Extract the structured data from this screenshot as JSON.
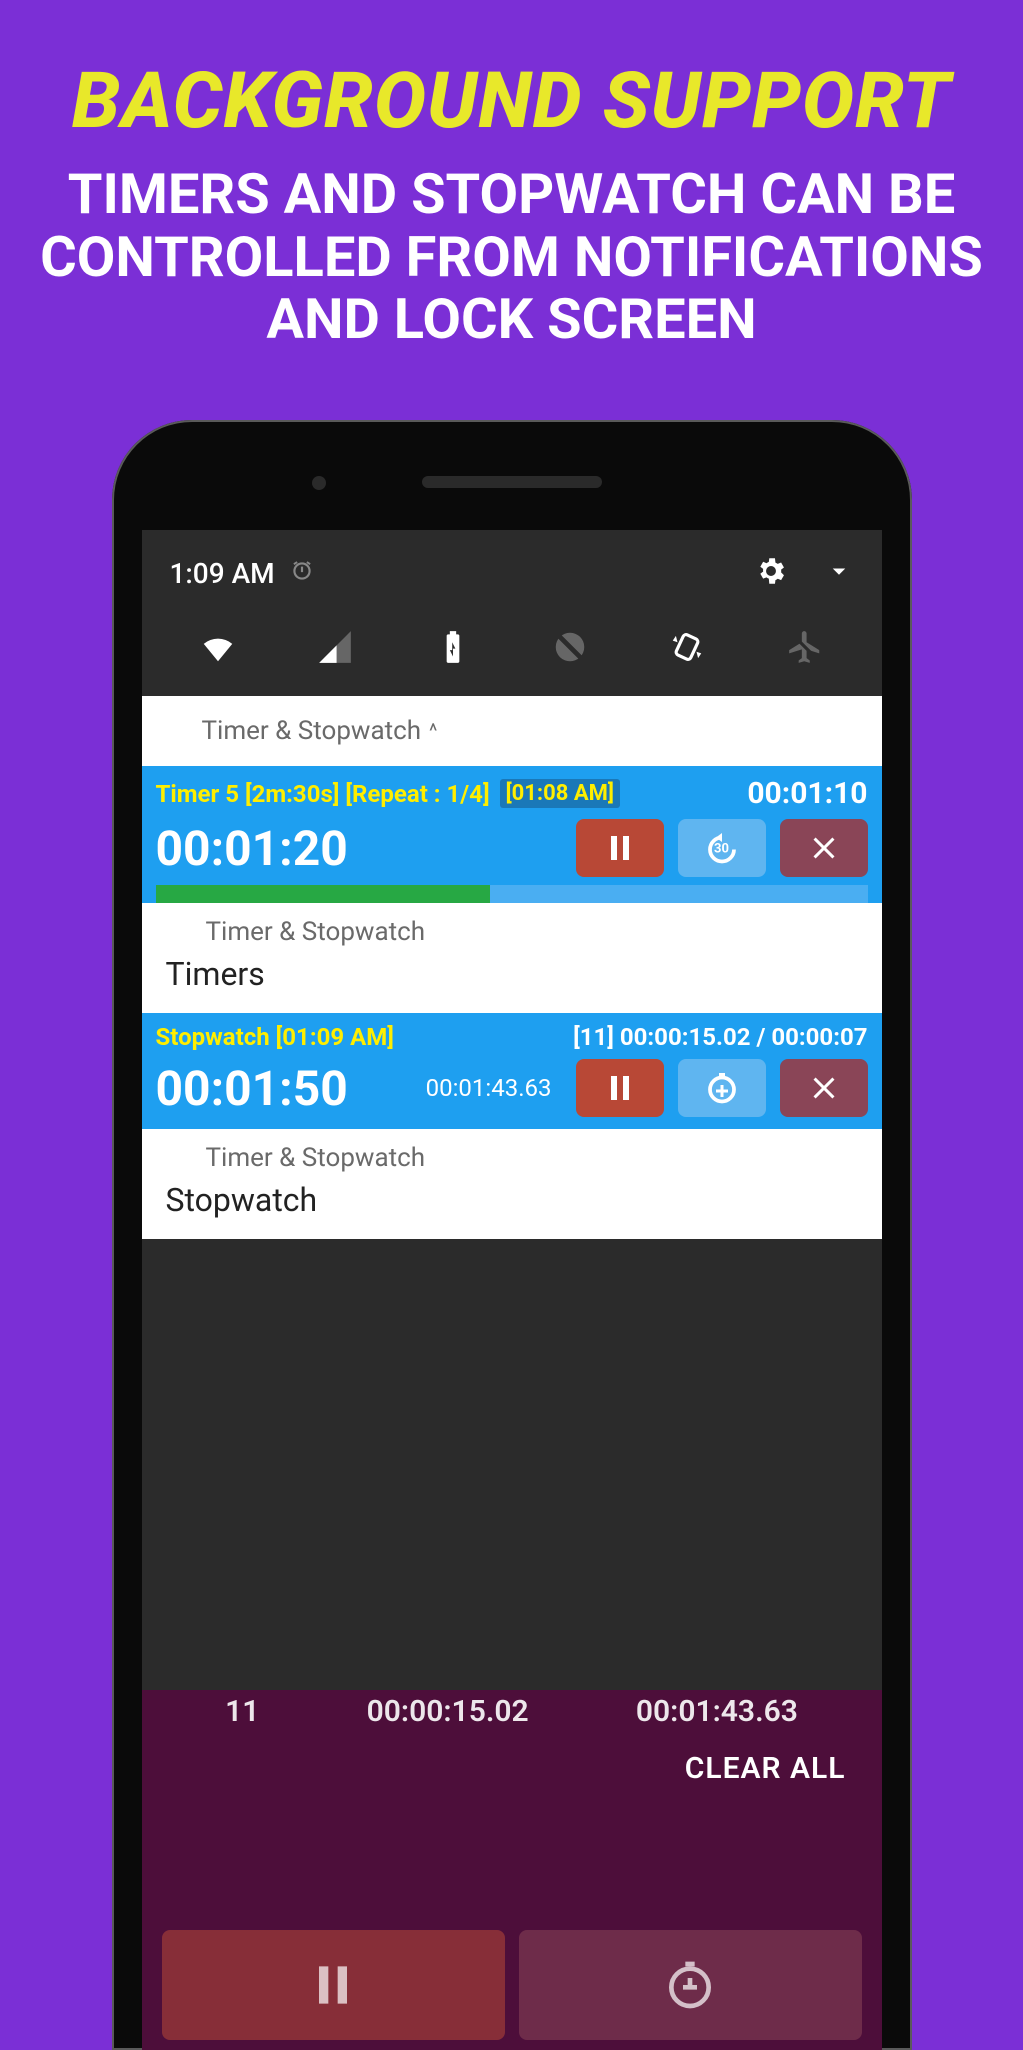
{
  "hero": {
    "title": "BACKGROUND SUPPORT",
    "subtitle": "TIMERS AND STOPWATCH CAN BE CONTROLLED FROM NOTIFICATIONS AND LOCK SCREEN"
  },
  "statusbar": {
    "time": "1:09 AM"
  },
  "notif_header": "Timer & Stopwatch",
  "timer": {
    "title": "Timer 5 [2m:30s] [Repeat : 1/4]",
    "clock": "[01:08 AM]",
    "remaining": "00:01:10",
    "elapsed": "00:01:20",
    "replay_num": "30",
    "progress_pct": 47
  },
  "timer_sub": {
    "small": "Timer & Stopwatch",
    "big": "Timers"
  },
  "stopwatch": {
    "title": "Stopwatch [01:09 AM]",
    "lap_info": "[11] 00:00:15.02 / 00:00:07",
    "main": "00:01:50",
    "sub": "00:01:43.63"
  },
  "stopwatch_sub": {
    "small": "Timer & Stopwatch",
    "big": "Stopwatch"
  },
  "behind": {
    "col1": "11",
    "col2": "00:00:15.02",
    "col3": "00:01:43.63",
    "clear_all": "CLEAR ALL"
  }
}
